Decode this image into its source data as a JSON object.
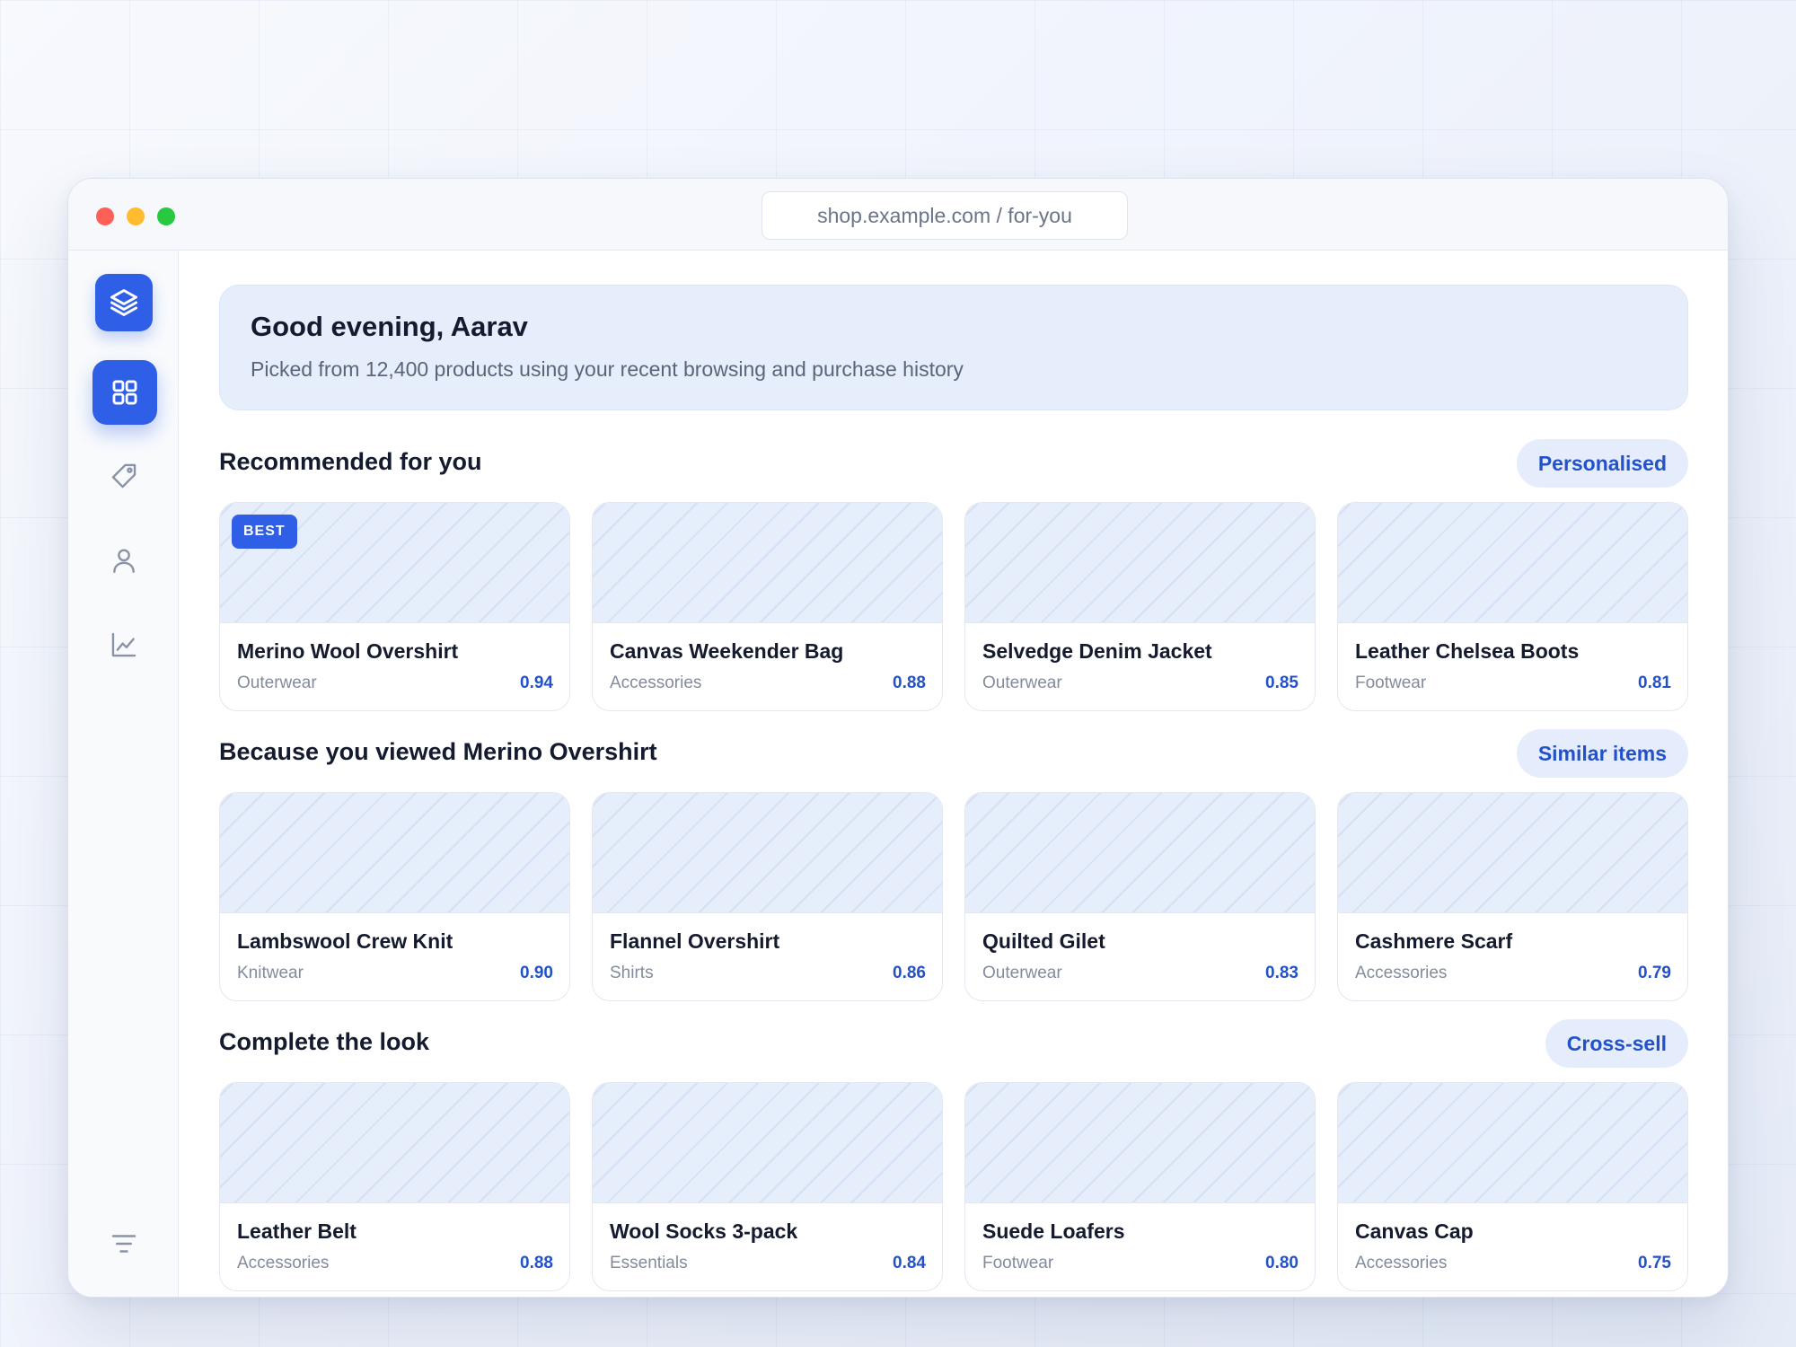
{
  "browser": {
    "url": "shop.example.com / for-you"
  },
  "sidebar": {
    "items": [
      {
        "icon": "layers-icon"
      },
      {
        "icon": "grid-icon"
      },
      {
        "icon": "tag-icon"
      },
      {
        "icon": "user-icon"
      },
      {
        "icon": "chart-icon"
      },
      {
        "icon": "filter-icon"
      }
    ]
  },
  "hero": {
    "title": "Good evening, Aarav",
    "subtitle": "Picked from 12,400 products using your recent browsing and purchase history"
  },
  "sections": [
    {
      "title": "Recommended for you",
      "pill": "Personalised",
      "items": [
        {
          "name": "Merino Wool Overshirt",
          "category": "Outerwear",
          "score": "0.94",
          "badge": "BEST"
        },
        {
          "name": "Canvas Weekender Bag",
          "category": "Accessories",
          "score": "0.88"
        },
        {
          "name": "Selvedge Denim Jacket",
          "category": "Outerwear",
          "score": "0.85"
        },
        {
          "name": "Leather Chelsea Boots",
          "category": "Footwear",
          "score": "0.81"
        }
      ]
    },
    {
      "title": "Because you viewed Merino Overshirt",
      "pill": "Similar items",
      "items": [
        {
          "name": "Lambswool Crew Knit",
          "category": "Knitwear",
          "score": "0.90"
        },
        {
          "name": "Flannel Overshirt",
          "category": "Shirts",
          "score": "0.86"
        },
        {
          "name": "Quilted Gilet",
          "category": "Outerwear",
          "score": "0.83"
        },
        {
          "name": "Cashmere Scarf",
          "category": "Accessories",
          "score": "0.79"
        }
      ]
    },
    {
      "title": "Complete the look",
      "pill": "Cross-sell",
      "items": [
        {
          "name": "Leather Belt",
          "category": "Accessories",
          "score": "0.88"
        },
        {
          "name": "Wool Socks 3-pack",
          "category": "Essentials",
          "score": "0.84"
        },
        {
          "name": "Suede Loafers",
          "category": "Footwear",
          "score": "0.80"
        },
        {
          "name": "Canvas Cap",
          "category": "Accessories",
          "score": "0.75"
        }
      ]
    }
  ],
  "colors": {
    "accent": "#2f5fe6",
    "accent_text": "#2352c8",
    "hero_bg": "#e6eefc"
  }
}
